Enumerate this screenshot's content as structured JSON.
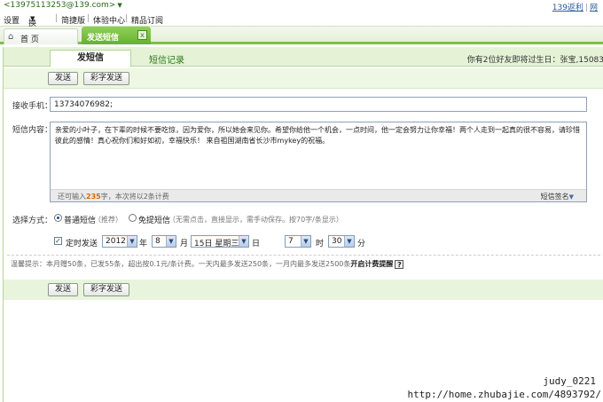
{
  "account": {
    "email": "<13975113253@139.com>",
    "dropdown": "▼"
  },
  "top_links": {
    "link1": "139返利",
    "sep": "|",
    "link2": "网"
  },
  "menu": [
    "设置",
    "换肤",
    "简捷版",
    "体验中心",
    "精品订阅"
  ],
  "tabs": {
    "home": "首 页",
    "sms": "发送短信",
    "close": "x"
  },
  "subtabs": {
    "active": "发短信",
    "other": "短信记录"
  },
  "birthday_notice": "你有2位好友即将过生日：张宝,15083",
  "buttons": {
    "send": "发送",
    "mms_send": "彩字发送"
  },
  "form": {
    "recipient_label": "接收手机：",
    "recipient_value": "13734076982;",
    "content_label": "短信内容：",
    "content_text": "亲爱的小叶子，在下辈的时候不要吃惊，因为爱你，所以她会来见你。希望你给他一个机会，一点时间，他一定会努力让你幸福！两个人走到一起真的很不容易，请珍惜彼此的感情！真心祝你们和好如初，幸福快乐！ 来自祖国湖南省长沙市mykey的祝福。",
    "counter_prefix": "还可输入",
    "counter_value": "235",
    "counter_suffix": "字，本次将以2条计费",
    "signature": "短信签名",
    "method_label": "选择方式：",
    "opt_normal": "普通短信",
    "opt_normal_hint": "（推荐）",
    "opt_free": "免提短信",
    "opt_free_hint": "（无需点击，直接显示，需手动保存。按70字/条显示）",
    "scheduled_label": "定时发送",
    "year": "2012",
    "year_unit": "年",
    "month": "8",
    "month_unit": "月",
    "day": "15日 星期三",
    "day_unit": "日",
    "hour": "7",
    "hour_unit": "时",
    "minute": "30",
    "minute_unit": "分"
  },
  "tip": {
    "text": "温馨提示：本月赠50条，已发55条，超出按0.1元/条计费。一天内最多发送250条，一月内最多发送2500条",
    "bold": "开启计费提醒",
    "q": "?"
  },
  "watermark": {
    "line1": "judy_0221",
    "line2": "http://home.zhubajie.com/4893792/"
  }
}
